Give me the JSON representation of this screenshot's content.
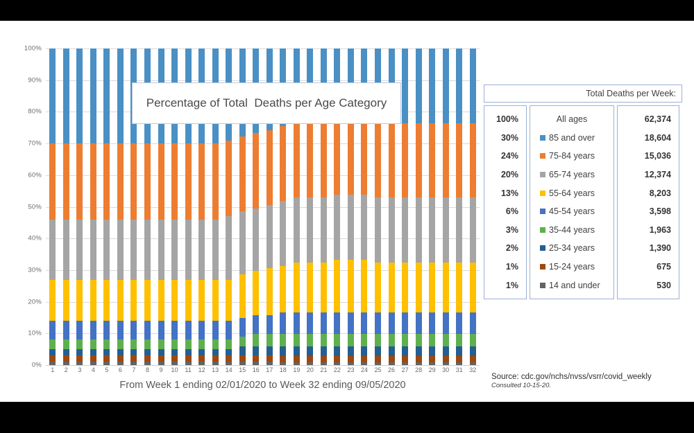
{
  "title": "Percentage of Total  Deaths per Age Category",
  "legend_header": "Total Deaths per Week:",
  "source": {
    "main": "Source: cdc.gov/nchs/nvss/vsrr/covid_weekly",
    "sub": "Consulted 10-15-20."
  },
  "xcaption": "From Week 1 ending 02/01/2020 to Week 32 ending 09/05/2020",
  "legend_rows": [
    {
      "pct": "100%",
      "name": "All ages",
      "value": "62,374",
      "color": null
    },
    {
      "pct": "30%",
      "name": "85 and over",
      "value": "18,604",
      "color": "#4A90C4"
    },
    {
      "pct": "24%",
      "name": "75-84 years",
      "value": "15,036",
      "color": "#ED7D31"
    },
    {
      "pct": "20%",
      "name": "65-74 years",
      "value": "12,374",
      "color": "#A5A5A5"
    },
    {
      "pct": "13%",
      "name": "55-64 years",
      "value": "8,203",
      "color": "#FFC000"
    },
    {
      "pct": "6%",
      "name": "45-54 years",
      "value": "3,598",
      "color": "#4472C4"
    },
    {
      "pct": "3%",
      "name": "35-44 years",
      "value": "1,963",
      "color": "#5EB04E"
    },
    {
      "pct": "2%",
      "name": "25-34 years",
      "value": "1,390",
      "color": "#255E91"
    },
    {
      "pct": "1%",
      "name": "15-24 years",
      "value": "675",
      "color": "#9E480E"
    },
    {
      "pct": "1%",
      "name": "14 and under",
      "value": "530",
      "color": "#636363"
    }
  ],
  "chart_data": {
    "type": "bar",
    "subtype": "stacked-100-percent",
    "title": "Percentage of Total  Deaths per Age Category",
    "xlabel": "From Week 1 ending 02/01/2020 to Week 32 ending 09/05/2020",
    "ylabel": "",
    "ylim": [
      0,
      100
    ],
    "yticks": [
      "0%",
      "10%",
      "20%",
      "30%",
      "40%",
      "50%",
      "60%",
      "70%",
      "80%",
      "90%",
      "100%"
    ],
    "grid": true,
    "legend_position": "right-table",
    "categories": [
      "1",
      "2",
      "3",
      "4",
      "5",
      "6",
      "7",
      "8",
      "9",
      "10",
      "11",
      "12",
      "13",
      "14",
      "15",
      "16",
      "17",
      "18",
      "19",
      "20",
      "21",
      "22",
      "23",
      "24",
      "25",
      "26",
      "27",
      "28",
      "29",
      "30",
      "31",
      "32"
    ],
    "series": [
      {
        "name": "14 and under",
        "color": "#636363",
        "values": [
          1,
          1,
          1,
          1,
          1,
          1,
          1,
          1,
          1,
          1,
          1,
          1,
          1,
          1,
          1,
          1,
          1,
          1,
          1,
          1,
          1,
          1,
          1,
          1,
          1,
          1,
          1,
          1,
          1,
          1,
          1,
          1
        ]
      },
      {
        "name": "15-24 years",
        "color": "#9E480E",
        "values": [
          2,
          2,
          2,
          2,
          2,
          2,
          2,
          2,
          2,
          2,
          2,
          2,
          2,
          2,
          2,
          2,
          2,
          2,
          2,
          2,
          2,
          2,
          2,
          2,
          2,
          2,
          2,
          2,
          2,
          2,
          2,
          2
        ]
      },
      {
        "name": "25-34 years",
        "color": "#255E91",
        "values": [
          2,
          2,
          2,
          2,
          2,
          2,
          2,
          2,
          2,
          2,
          2,
          2,
          2,
          2,
          3,
          3,
          3,
          3,
          3,
          3,
          3,
          3,
          3,
          3,
          3,
          3,
          3,
          3,
          3,
          3,
          3,
          3
        ]
      },
      {
        "name": "35-44 years",
        "color": "#5EB04E",
        "values": [
          3,
          3,
          3,
          3,
          3,
          3,
          3,
          3,
          3,
          3,
          3,
          3,
          3,
          3,
          3,
          4,
          4,
          4,
          4,
          4,
          4,
          4,
          4,
          4,
          4,
          4,
          4,
          4,
          4,
          4,
          4,
          4
        ]
      },
      {
        "name": "45-54 years",
        "color": "#4472C4",
        "values": [
          6,
          6,
          6,
          6,
          6,
          6,
          6,
          6,
          6,
          6,
          6,
          6,
          6,
          6,
          6,
          6,
          6,
          7,
          7,
          7,
          7,
          7,
          7,
          7,
          7,
          7,
          7,
          7,
          7,
          7,
          7,
          7
        ]
      },
      {
        "name": "55-64 years",
        "color": "#FFC000",
        "values": [
          13,
          13,
          13,
          13,
          13,
          13,
          13,
          13,
          13,
          13,
          13,
          13,
          13,
          13,
          14,
          14,
          15,
          15,
          16,
          16,
          16,
          17,
          17,
          17,
          16,
          16,
          16,
          16,
          16,
          16,
          16,
          16
        ]
      },
      {
        "name": "65-74 years",
        "color": "#A5A5A5",
        "values": [
          19,
          19,
          19,
          19,
          19,
          19,
          19,
          19,
          19,
          19,
          19,
          19,
          19,
          20,
          20,
          20,
          20,
          21,
          21,
          21,
          21,
          21,
          21,
          21,
          21,
          21,
          21,
          21,
          21,
          21,
          21,
          21
        ]
      },
      {
        "name": "75-84 years",
        "color": "#ED7D31",
        "values": [
          24,
          24,
          24,
          24,
          24,
          24,
          24,
          24,
          24,
          24,
          24,
          24,
          24,
          24,
          24,
          24,
          24,
          24,
          24,
          24,
          24,
          24,
          24,
          24,
          24,
          24,
          24,
          24,
          24,
          24,
          24,
          24
        ]
      },
      {
        "name": "85 and over",
        "color": "#4A90C4",
        "values": [
          30,
          30,
          30,
          30,
          30,
          30,
          30,
          30,
          30,
          30,
          30,
          30,
          30,
          29,
          28,
          27,
          26,
          25,
          24,
          24,
          24,
          23,
          23,
          23,
          24,
          24,
          24,
          24,
          24,
          24,
          24,
          24
        ]
      }
    ]
  }
}
